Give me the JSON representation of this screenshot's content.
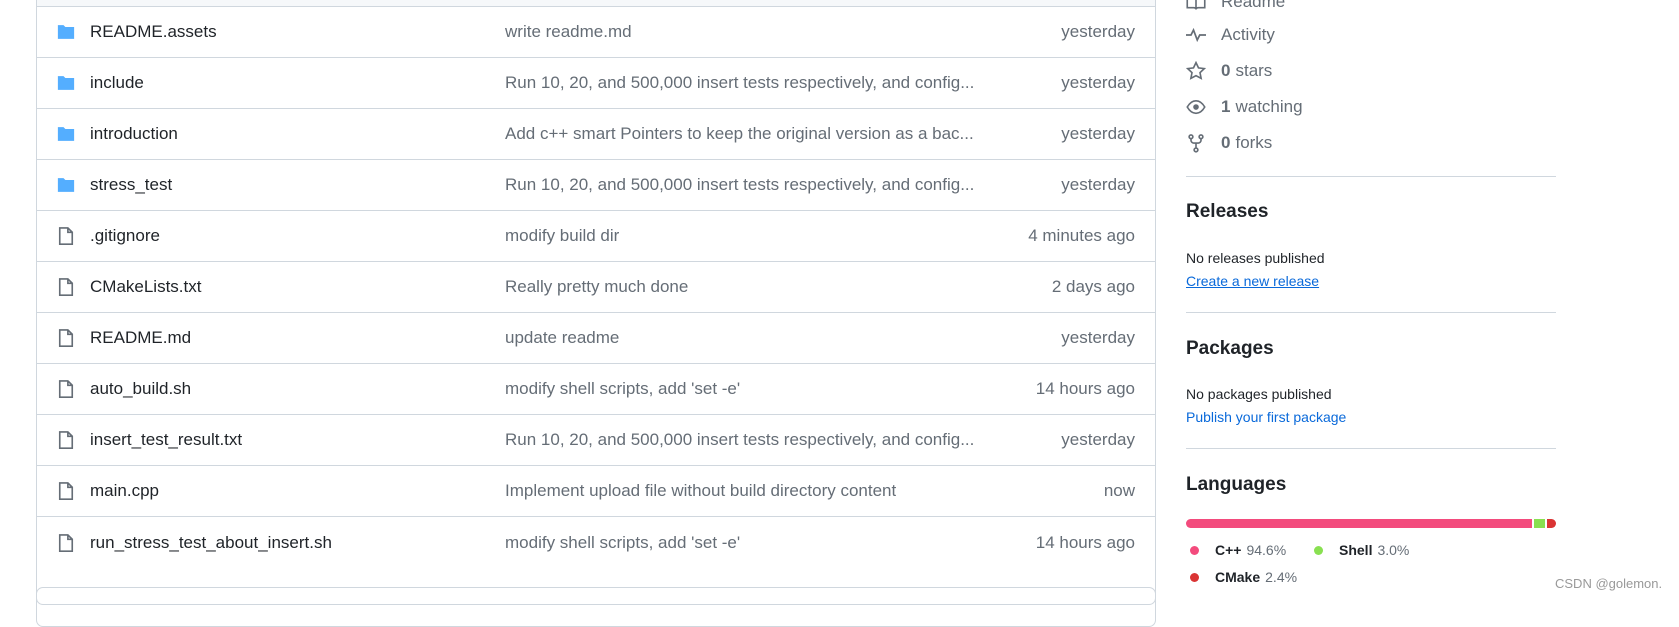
{
  "files": [
    {
      "type": "folder",
      "name": "README.assets",
      "message": "write readme.md",
      "date": "yesterday"
    },
    {
      "type": "folder",
      "name": "include",
      "message": "Run 10, 20, and 500,000 insert tests respectively, and config...",
      "date": "yesterday"
    },
    {
      "type": "folder",
      "name": "introduction",
      "message": "Add c++ smart Pointers to keep the original version as a bac...",
      "date": "yesterday"
    },
    {
      "type": "folder",
      "name": "stress_test",
      "message": "Run 10, 20, and 500,000 insert tests respectively, and config...",
      "date": "yesterday"
    },
    {
      "type": "file",
      "name": ".gitignore",
      "message": "modify build dir",
      "date": "4 minutes ago"
    },
    {
      "type": "file",
      "name": "CMakeLists.txt",
      "message": "Really pretty much done",
      "date": "2 days ago"
    },
    {
      "type": "file",
      "name": "README.md",
      "message": "update readme",
      "date": "yesterday"
    },
    {
      "type": "file",
      "name": "auto_build.sh",
      "message": "modify shell scripts, add 'set -e'",
      "date": "14 hours ago"
    },
    {
      "type": "file",
      "name": "insert_test_result.txt",
      "message": "Run 10, 20, and 500,000 insert tests respectively, and config...",
      "date": "yesterday"
    },
    {
      "type": "file",
      "name": "main.cpp",
      "message": "Implement upload file without build directory content",
      "date": "now"
    },
    {
      "type": "file",
      "name": "run_stress_test_about_insert.sh",
      "message": "modify shell scripts, add 'set -e'",
      "date": "14 hours ago"
    }
  ],
  "sidebar": {
    "readme": "Readme",
    "activity": "Activity",
    "stars": {
      "count": "0",
      "label": "stars"
    },
    "watching": {
      "count": "1",
      "label": "watching"
    },
    "forks": {
      "count": "0",
      "label": "forks"
    },
    "releases": {
      "title": "Releases",
      "empty": "No releases published",
      "link": "Create a new release"
    },
    "packages": {
      "title": "Packages",
      "empty": "No packages published",
      "link": "Publish your first package"
    },
    "languages": {
      "title": "Languages",
      "items": [
        {
          "name": "C++",
          "percent": "94.6%",
          "value": 94.6,
          "color": "#f34b7d"
        },
        {
          "name": "Shell",
          "percent": "3.0%",
          "value": 3.0,
          "color": "#89e051"
        },
        {
          "name": "CMake",
          "percent": "2.4%",
          "value": 2.4,
          "color": "#da3434"
        }
      ]
    }
  },
  "watermark": "CSDN @golemon."
}
